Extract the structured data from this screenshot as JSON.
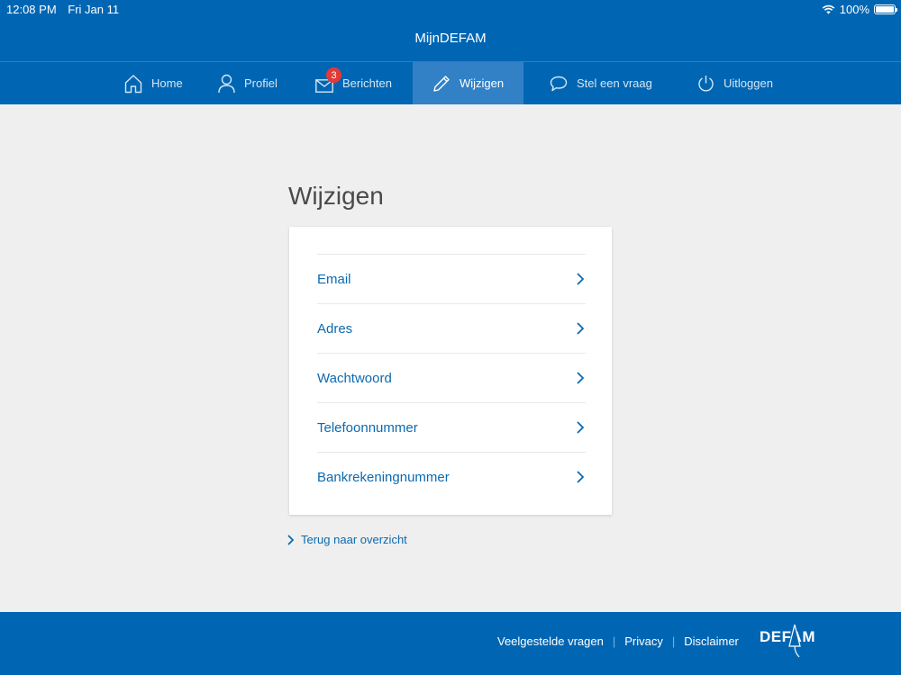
{
  "status": {
    "time": "12:08 PM",
    "date": "Fri Jan 11",
    "battery": "100%"
  },
  "app": {
    "title": "MijnDEFAM"
  },
  "nav": {
    "home": "Home",
    "profiel": "Profiel",
    "berichten": "Berichten",
    "berichten_badge": "3",
    "wijzigen": "Wijzigen",
    "vraag": "Stel een vraag",
    "uitloggen": "Uitloggen"
  },
  "page": {
    "title": "Wijzigen",
    "items": [
      {
        "label": "Email"
      },
      {
        "label": "Adres"
      },
      {
        "label": "Wachtwoord"
      },
      {
        "label": "Telefoonnummer"
      },
      {
        "label": "Bankrekeningnummer"
      }
    ],
    "back": "Terug naar overzicht"
  },
  "footer": {
    "faq": "Veelgestelde vragen",
    "privacy": "Privacy",
    "disclaimer": "Disclaimer",
    "logo": "DEFAM"
  },
  "colors": {
    "brand": "#0066b3",
    "active_tab": "#3281c6",
    "link": "#0c6ab0",
    "badge": "#e53935",
    "background": "#efefef"
  }
}
